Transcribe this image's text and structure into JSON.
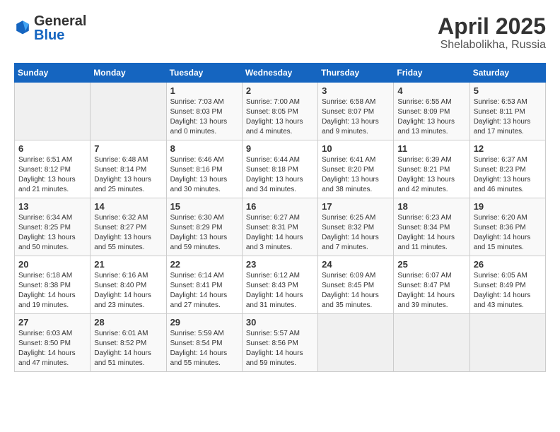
{
  "logo": {
    "general": "General",
    "blue": "Blue"
  },
  "title": "April 2025",
  "location": "Shelabolikha, Russia",
  "days_of_week": [
    "Sunday",
    "Monday",
    "Tuesday",
    "Wednesday",
    "Thursday",
    "Friday",
    "Saturday"
  ],
  "weeks": [
    [
      {
        "day": "",
        "info": ""
      },
      {
        "day": "",
        "info": ""
      },
      {
        "day": "1",
        "info": "Sunrise: 7:03 AM\nSunset: 8:03 PM\nDaylight: 13 hours\nand 0 minutes."
      },
      {
        "day": "2",
        "info": "Sunrise: 7:00 AM\nSunset: 8:05 PM\nDaylight: 13 hours\nand 4 minutes."
      },
      {
        "day": "3",
        "info": "Sunrise: 6:58 AM\nSunset: 8:07 PM\nDaylight: 13 hours\nand 9 minutes."
      },
      {
        "day": "4",
        "info": "Sunrise: 6:55 AM\nSunset: 8:09 PM\nDaylight: 13 hours\nand 13 minutes."
      },
      {
        "day": "5",
        "info": "Sunrise: 6:53 AM\nSunset: 8:11 PM\nDaylight: 13 hours\nand 17 minutes."
      }
    ],
    [
      {
        "day": "6",
        "info": "Sunrise: 6:51 AM\nSunset: 8:12 PM\nDaylight: 13 hours\nand 21 minutes."
      },
      {
        "day": "7",
        "info": "Sunrise: 6:48 AM\nSunset: 8:14 PM\nDaylight: 13 hours\nand 25 minutes."
      },
      {
        "day": "8",
        "info": "Sunrise: 6:46 AM\nSunset: 8:16 PM\nDaylight: 13 hours\nand 30 minutes."
      },
      {
        "day": "9",
        "info": "Sunrise: 6:44 AM\nSunset: 8:18 PM\nDaylight: 13 hours\nand 34 minutes."
      },
      {
        "day": "10",
        "info": "Sunrise: 6:41 AM\nSunset: 8:20 PM\nDaylight: 13 hours\nand 38 minutes."
      },
      {
        "day": "11",
        "info": "Sunrise: 6:39 AM\nSunset: 8:21 PM\nDaylight: 13 hours\nand 42 minutes."
      },
      {
        "day": "12",
        "info": "Sunrise: 6:37 AM\nSunset: 8:23 PM\nDaylight: 13 hours\nand 46 minutes."
      }
    ],
    [
      {
        "day": "13",
        "info": "Sunrise: 6:34 AM\nSunset: 8:25 PM\nDaylight: 13 hours\nand 50 minutes."
      },
      {
        "day": "14",
        "info": "Sunrise: 6:32 AM\nSunset: 8:27 PM\nDaylight: 13 hours\nand 55 minutes."
      },
      {
        "day": "15",
        "info": "Sunrise: 6:30 AM\nSunset: 8:29 PM\nDaylight: 13 hours\nand 59 minutes."
      },
      {
        "day": "16",
        "info": "Sunrise: 6:27 AM\nSunset: 8:31 PM\nDaylight: 14 hours\nand 3 minutes."
      },
      {
        "day": "17",
        "info": "Sunrise: 6:25 AM\nSunset: 8:32 PM\nDaylight: 14 hours\nand 7 minutes."
      },
      {
        "day": "18",
        "info": "Sunrise: 6:23 AM\nSunset: 8:34 PM\nDaylight: 14 hours\nand 11 minutes."
      },
      {
        "day": "19",
        "info": "Sunrise: 6:20 AM\nSunset: 8:36 PM\nDaylight: 14 hours\nand 15 minutes."
      }
    ],
    [
      {
        "day": "20",
        "info": "Sunrise: 6:18 AM\nSunset: 8:38 PM\nDaylight: 14 hours\nand 19 minutes."
      },
      {
        "day": "21",
        "info": "Sunrise: 6:16 AM\nSunset: 8:40 PM\nDaylight: 14 hours\nand 23 minutes."
      },
      {
        "day": "22",
        "info": "Sunrise: 6:14 AM\nSunset: 8:41 PM\nDaylight: 14 hours\nand 27 minutes."
      },
      {
        "day": "23",
        "info": "Sunrise: 6:12 AM\nSunset: 8:43 PM\nDaylight: 14 hours\nand 31 minutes."
      },
      {
        "day": "24",
        "info": "Sunrise: 6:09 AM\nSunset: 8:45 PM\nDaylight: 14 hours\nand 35 minutes."
      },
      {
        "day": "25",
        "info": "Sunrise: 6:07 AM\nSunset: 8:47 PM\nDaylight: 14 hours\nand 39 minutes."
      },
      {
        "day": "26",
        "info": "Sunrise: 6:05 AM\nSunset: 8:49 PM\nDaylight: 14 hours\nand 43 minutes."
      }
    ],
    [
      {
        "day": "27",
        "info": "Sunrise: 6:03 AM\nSunset: 8:50 PM\nDaylight: 14 hours\nand 47 minutes."
      },
      {
        "day": "28",
        "info": "Sunrise: 6:01 AM\nSunset: 8:52 PM\nDaylight: 14 hours\nand 51 minutes."
      },
      {
        "day": "29",
        "info": "Sunrise: 5:59 AM\nSunset: 8:54 PM\nDaylight: 14 hours\nand 55 minutes."
      },
      {
        "day": "30",
        "info": "Sunrise: 5:57 AM\nSunset: 8:56 PM\nDaylight: 14 hours\nand 59 minutes."
      },
      {
        "day": "",
        "info": ""
      },
      {
        "day": "",
        "info": ""
      },
      {
        "day": "",
        "info": ""
      }
    ]
  ]
}
